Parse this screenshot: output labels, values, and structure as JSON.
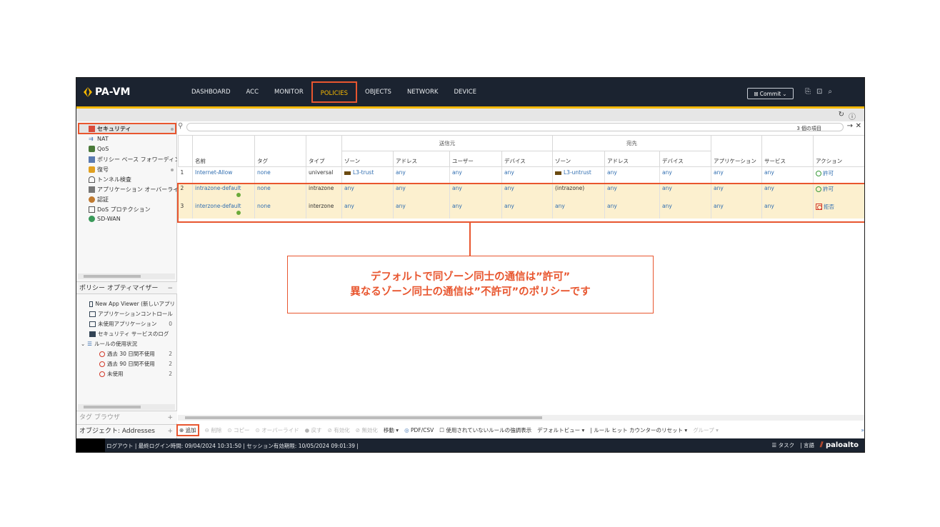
{
  "app": {
    "logo": "PA-VM"
  },
  "nav": [
    "DASHBOARD",
    "ACC",
    "MONITOR",
    "POLICIES",
    "OBJECTS",
    "NETWORK",
    "DEVICE"
  ],
  "commit_label": "Commit",
  "sidebar": {
    "items": [
      {
        "label": "セキュリティ",
        "icon": "security-icon"
      },
      {
        "label": "NAT",
        "icon": "nat-icon"
      },
      {
        "label": "QoS",
        "icon": "qos-icon"
      },
      {
        "label": "ポリシー ベース フォワーディング",
        "icon": "pbf-icon"
      },
      {
        "label": "復号",
        "icon": "decryption-icon"
      },
      {
        "label": "トンネル検査",
        "icon": "tunnel-icon"
      },
      {
        "label": "アプリケーション オーバーライド",
        "icon": "app-override-icon"
      },
      {
        "label": "認証",
        "icon": "auth-icon"
      },
      {
        "label": "DoS プロテクション",
        "icon": "dos-icon"
      },
      {
        "label": "SD-WAN",
        "icon": "sdwan-icon"
      }
    ]
  },
  "optimizer": {
    "title": "ポリシー オプティマイザー",
    "items": [
      {
        "label": "New App Viewer (新しいアプリ",
        "count": ""
      },
      {
        "label": "アプリケーションコントロール",
        "count": ""
      },
      {
        "label": "未使用アプリケーション",
        "count": "0"
      },
      {
        "label": "セキュリティ サービスのログ",
        "count": ""
      },
      {
        "label": "ルールの使用状況",
        "count": ""
      },
      {
        "label": "過去 30 日間不使用",
        "count": "2"
      },
      {
        "label": "過去 90 日間不使用",
        "count": "2"
      },
      {
        "label": "未使用",
        "count": "2"
      }
    ]
  },
  "tag_browser": "タグ ブラウザ",
  "objects_panel": "オブジェクト: Addresses",
  "search": {
    "count": "3 個の項目"
  },
  "table": {
    "group_source": "送信元",
    "group_dest": "宛先",
    "headers": [
      "名前",
      "タグ",
      "タイプ",
      "ゾーン",
      "アドレス",
      "ユーザー",
      "デバイス",
      "ゾーン",
      "アドレス",
      "デバイス",
      "アプリケーション",
      "サービス",
      "アクション"
    ],
    "rows": [
      {
        "num": "1",
        "name": "Internet-Allow",
        "tag": "none",
        "type": "universal",
        "src_zone": "L3-trust",
        "src_addr": "any",
        "src_user": "any",
        "src_dev": "any",
        "dst_zone": "L3-untrust",
        "dst_addr": "any",
        "dst_dev": "any",
        "app": "any",
        "service": "any",
        "action": "許可"
      },
      {
        "num": "2",
        "name": "intrazone-default",
        "tag": "none",
        "type": "intrazone",
        "src_zone": "any",
        "src_addr": "any",
        "src_user": "any",
        "src_dev": "any",
        "dst_zone": "(intrazone)",
        "dst_addr": "any",
        "dst_dev": "any",
        "app": "any",
        "service": "any",
        "action": "許可"
      },
      {
        "num": "3",
        "name": "interzone-default",
        "tag": "none",
        "type": "interzone",
        "src_zone": "any",
        "src_addr": "any",
        "src_user": "any",
        "src_dev": "any",
        "dst_zone": "any",
        "dst_addr": "any",
        "dst_dev": "any",
        "app": "any",
        "service": "any",
        "action": "拒否"
      }
    ]
  },
  "actions": {
    "add": "追加",
    "delete": "削除",
    "copy": "コピー",
    "override": "オーバーライド",
    "revert": "戻す",
    "enable": "有効化",
    "disable": "無効化",
    "move": "移動",
    "pdf": "PDF/CSV",
    "highlight_unused": "使用されていないルールの強調表示",
    "default_view": "デフォルトビュー",
    "reset_hits": "ルール ヒット カウンターのリセット",
    "group": "グループ"
  },
  "status": {
    "text": "ログアウト | 最終ログイン時間: 09/04/2024 10:31:50 | セッション有効期限: 10/05/2024 09:01:39 |",
    "tasks": "タスク",
    "language": "言語",
    "brand": "paloalto"
  },
  "callout": {
    "line1": "デフォルトで同ゾーン同士の通信は”許可”",
    "line2": "異なるゾーン同士の通信は”不許可”のポリシーです"
  },
  "colors": {
    "accent": "#e8562f",
    "topbar": "#1b2330",
    "brand_yellow": "#f5b800",
    "row_highlight": "#fcf0cf",
    "link": "#2f6db0"
  }
}
